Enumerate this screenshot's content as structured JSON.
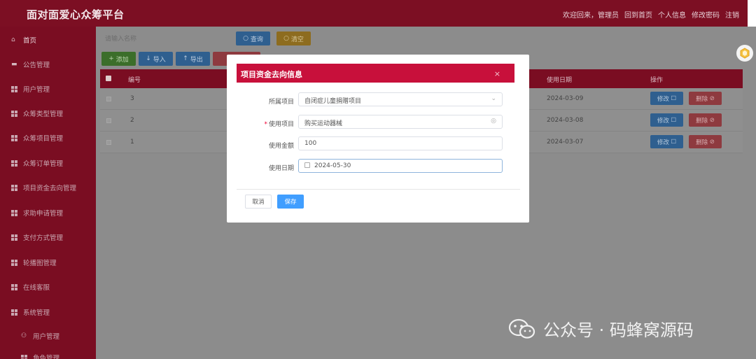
{
  "app": {
    "title": "面对面爱心众筹平台"
  },
  "header": {
    "welcome": "欢迎回来，管理员",
    "home_link": "回到首页",
    "profile_link": "个人信息",
    "password_link": "修改密码",
    "logout_link": "注销"
  },
  "sidebar": {
    "items": [
      {
        "label": "首页"
      },
      {
        "label": "公告管理"
      },
      {
        "label": "用户管理"
      },
      {
        "label": "众筹类型管理"
      },
      {
        "label": "众筹项目管理"
      },
      {
        "label": "众筹订单管理"
      },
      {
        "label": "项目资金去向管理"
      },
      {
        "label": "求助申请管理"
      },
      {
        "label": "支付方式管理"
      },
      {
        "label": "轮播图管理"
      },
      {
        "label": "在线客服"
      },
      {
        "label": "系统管理"
      },
      {
        "label": "用户管理"
      },
      {
        "label": "角色管理"
      }
    ]
  },
  "toolbar": {
    "search_placeholder": "请输入名称",
    "query_label": "查询",
    "clear_label": "清空",
    "add_label": "添加",
    "import_label": "导入",
    "export_label": "导出"
  },
  "table": {
    "columns": [
      "编号",
      "使用日期",
      "操作"
    ],
    "rows": [
      {
        "id": "3",
        "date": "2024-03-09"
      },
      {
        "id": "2",
        "date": "2024-03-08"
      },
      {
        "id": "1",
        "date": "2024-03-07"
      }
    ],
    "edit_label": "修改",
    "delete_label": "删除"
  },
  "modal": {
    "title": "项目资金去向信息",
    "close": "×",
    "fields": {
      "project_label": "所属项目",
      "project_value": "自闭症儿童捐赠项目",
      "usage_label": "使用项目",
      "usage_value": "购买运动器械",
      "amount_label": "使用金额",
      "amount_value": "100",
      "date_label": "使用日期",
      "date_value": "2024-05-30"
    },
    "cancel_label": "取消",
    "save_label": "保存"
  },
  "watermark": {
    "text": "公众号 · 码蜂窝源码"
  },
  "colors": {
    "brand": "#c8103b",
    "sidebar": "#7a0d22",
    "primary": "#409eff"
  }
}
